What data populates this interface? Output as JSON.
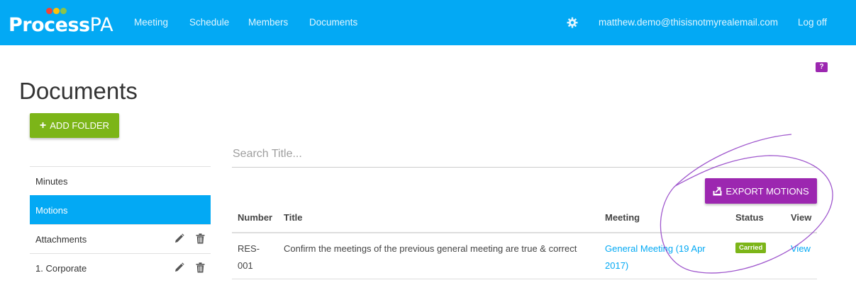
{
  "header": {
    "logo": {
      "main": "Process",
      "suffix": "PA",
      "dot_colors": [
        "#f44336",
        "#ffc107",
        "#8bc34a"
      ]
    },
    "nav": [
      {
        "label": "Meeting"
      },
      {
        "label": "Schedule"
      },
      {
        "label": "Members"
      },
      {
        "label": "Documents"
      }
    ],
    "settings_icon": "gear-icon",
    "user_email": "matthew.demo@thisisnotmyrealemail.com",
    "logoff_label": "Log off"
  },
  "help_badge": "?",
  "page": {
    "title": "Documents"
  },
  "add_folder": {
    "label": "ADD FOLDER",
    "icon": "plus-icon"
  },
  "folders": [
    {
      "label": "Minutes",
      "active": false,
      "editable": false
    },
    {
      "label": "Motions",
      "active": true,
      "editable": false
    },
    {
      "label": "Attachments",
      "active": false,
      "editable": true
    },
    {
      "label": "1. Corporate",
      "active": false,
      "editable": true
    }
  ],
  "search": {
    "placeholder": "Search Title...",
    "value": ""
  },
  "export": {
    "label": "EXPORT MOTIONS",
    "icon": "export-icon"
  },
  "table": {
    "columns": [
      "Number",
      "Title",
      "Meeting",
      "Status",
      "View"
    ],
    "rows": [
      {
        "number_line1": "RES-",
        "number_line2": "001",
        "title": "Confirm the meetings of the previous general meeting are true & correct",
        "meeting_line1": "General Meeting (19 Apr",
        "meeting_line2": "2017)",
        "status": "Carried",
        "view": "View"
      }
    ]
  },
  "colors": {
    "primary": "#03a9f4",
    "success": "#7cb518",
    "accent": "#9c27b0"
  }
}
